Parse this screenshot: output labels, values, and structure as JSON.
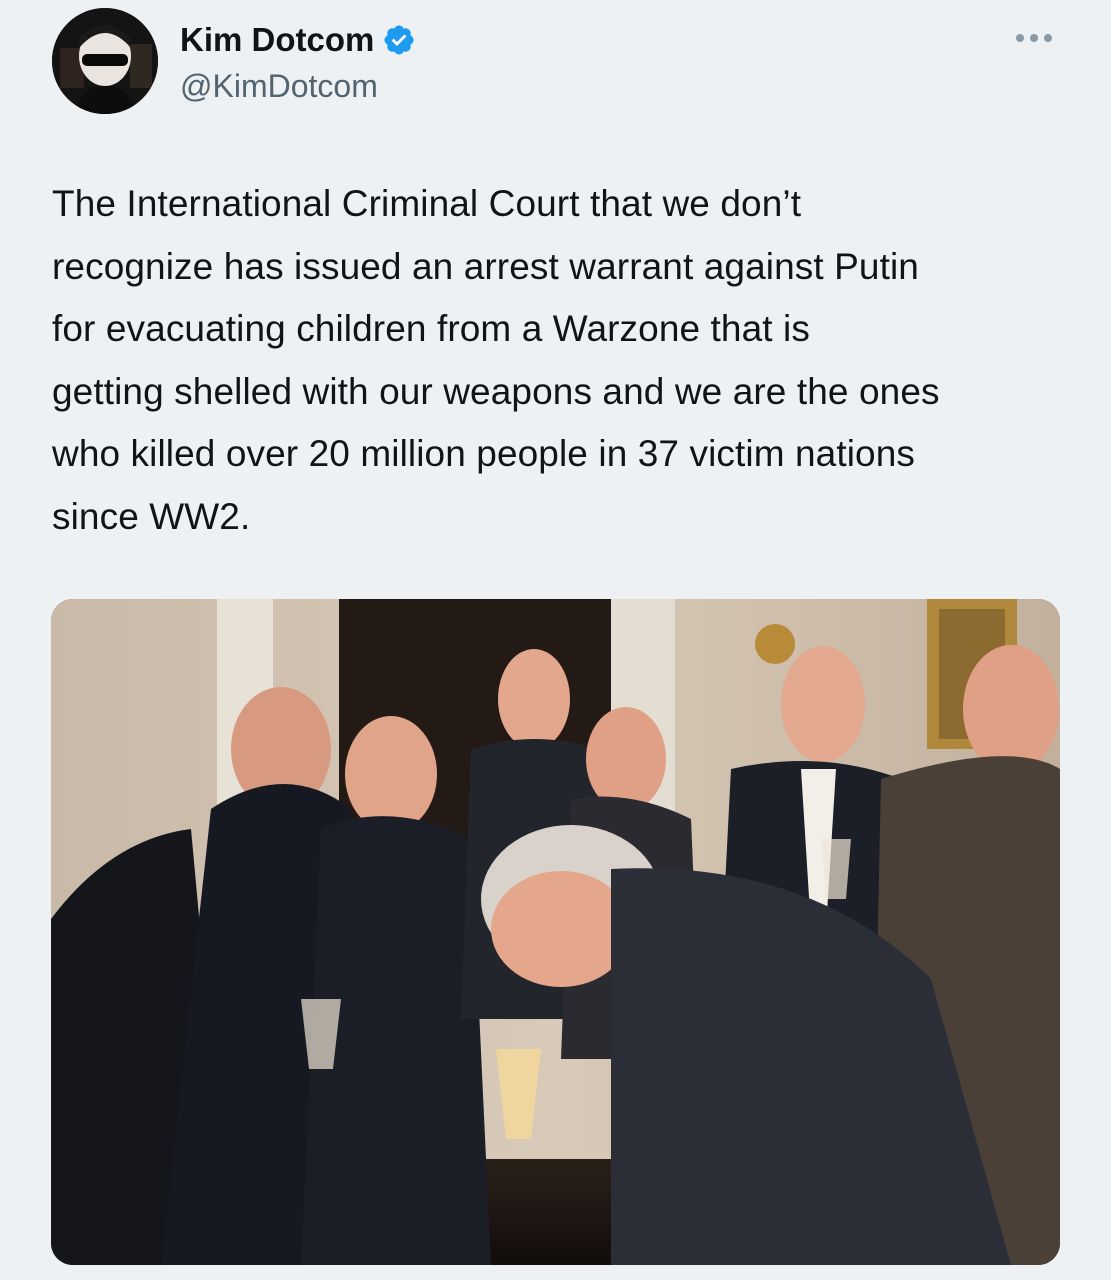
{
  "tweet": {
    "author": {
      "display_name": "Kim Dotcom",
      "handle": "@KimDotcom",
      "verified": true,
      "verified_color": "#1d9bf0"
    },
    "menu_icon": "more-options-icon",
    "text": "The International Criminal Court that we don’t\nrecognize has issued an arrest warrant against Putin\nfor evacuating children from a Warzone that is\ngetting shelled with our weapons and we are the ones\nwho killed over 20 million people in 37 victim nations\nsince WW2."
  },
  "colors": {
    "background": "#eef1f3",
    "text": "#0f1419",
    "secondary_text": "#536471"
  }
}
